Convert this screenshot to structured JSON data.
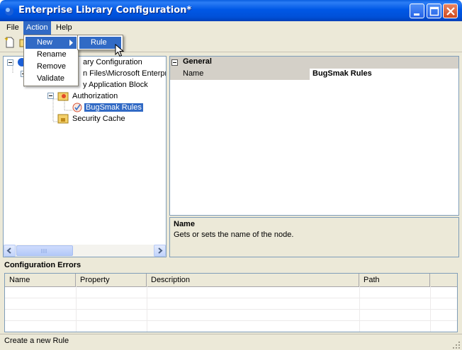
{
  "window": {
    "title": "Enterprise Library Configuration*"
  },
  "menubar": {
    "file": "File",
    "action": "Action",
    "help": "Help"
  },
  "action_menu": {
    "items": [
      "New",
      "Rename",
      "Remove",
      "Validate"
    ]
  },
  "new_submenu": {
    "items": [
      "Rule"
    ]
  },
  "tree": {
    "nodes": [
      {
        "label": "ary Configuration"
      },
      {
        "label": "n Files\\Microsoft Enterpris"
      },
      {
        "label": "y Application Block"
      },
      {
        "label": "Authorization"
      },
      {
        "label": "BugSmak Rules",
        "selected": true
      },
      {
        "label": "Security Cache"
      }
    ]
  },
  "properties": {
    "category": "General",
    "rows": [
      {
        "name": "Name",
        "value": "BugSmak Rules"
      }
    ]
  },
  "description": {
    "title": "Name",
    "text": "Gets or sets the name of the node."
  },
  "errors": {
    "title": "Configuration Errors",
    "columns": [
      "Name",
      "Property",
      "Description",
      "Path"
    ]
  },
  "statusbar": {
    "text": "Create a new Rule"
  },
  "colors": {
    "titlebar": "#0058e6",
    "highlight": "#316ac5",
    "chrome": "#ece9d8"
  },
  "icons": [
    "app-icon",
    "minimize-icon",
    "maximize-icon",
    "close-icon",
    "new-document-icon",
    "folder-icon",
    "authorization-icon",
    "rule-icon",
    "security-cache-icon",
    "submenu-arrow-icon",
    "mouse-cursor-icon"
  ]
}
